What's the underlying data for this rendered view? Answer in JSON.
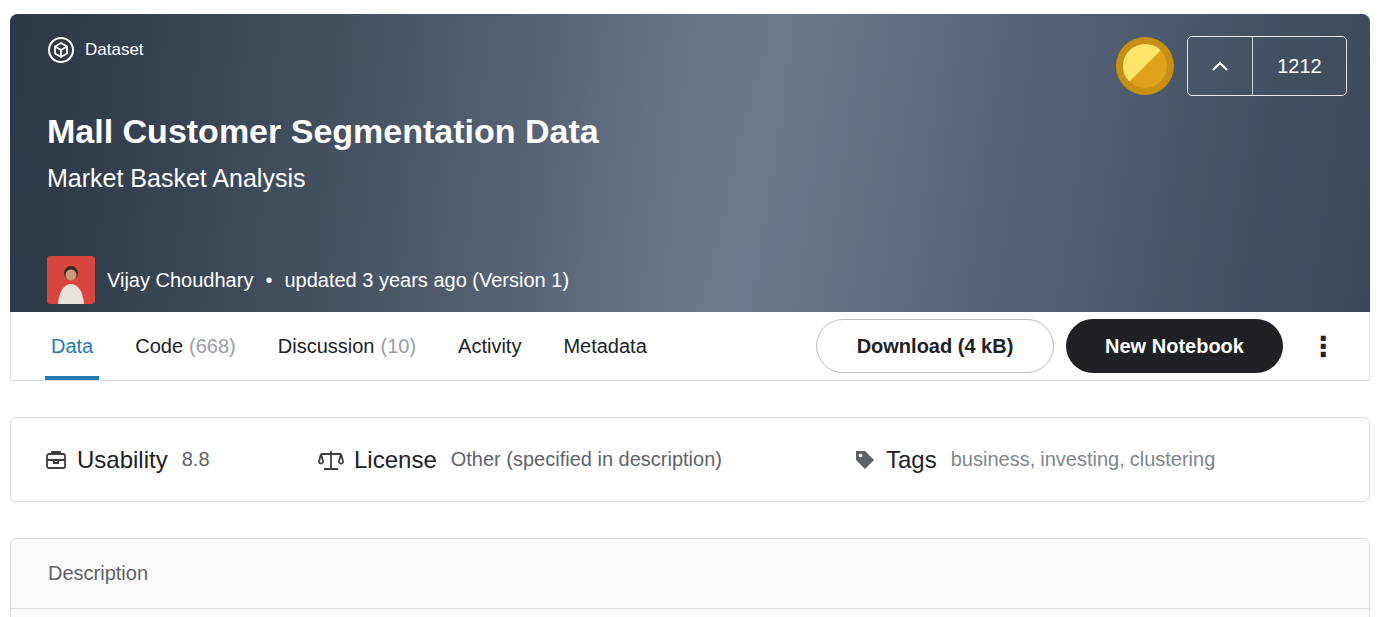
{
  "header": {
    "type_label": "Dataset",
    "title": "Mall Customer Segmentation Data",
    "subtitle": "Market Basket Analysis",
    "author": "Vijay Choudhary",
    "separator": "•",
    "updated": "updated 3 years ago (Version 1)",
    "upvote_count": "1212"
  },
  "tabs": [
    {
      "label": "Data",
      "count": "",
      "selected": true
    },
    {
      "label": "Code",
      "count": "(668)",
      "selected": false
    },
    {
      "label": "Discussion",
      "count": "(10)",
      "selected": false
    },
    {
      "label": "Activity",
      "count": "",
      "selected": false
    },
    {
      "label": "Metadata",
      "count": "",
      "selected": false
    }
  ],
  "actions": {
    "download": "Download (4 kB)",
    "new_notebook": "New Notebook",
    "more": "⋮"
  },
  "meta": {
    "usability": {
      "label": "Usability",
      "value": "8.8"
    },
    "license": {
      "label": "License",
      "value": "Other (specified in description)"
    },
    "tags": {
      "label": "Tags",
      "separator": ",",
      "items": [
        "business",
        "investing",
        "clustering"
      ]
    }
  },
  "description": {
    "title": "Description"
  }
}
